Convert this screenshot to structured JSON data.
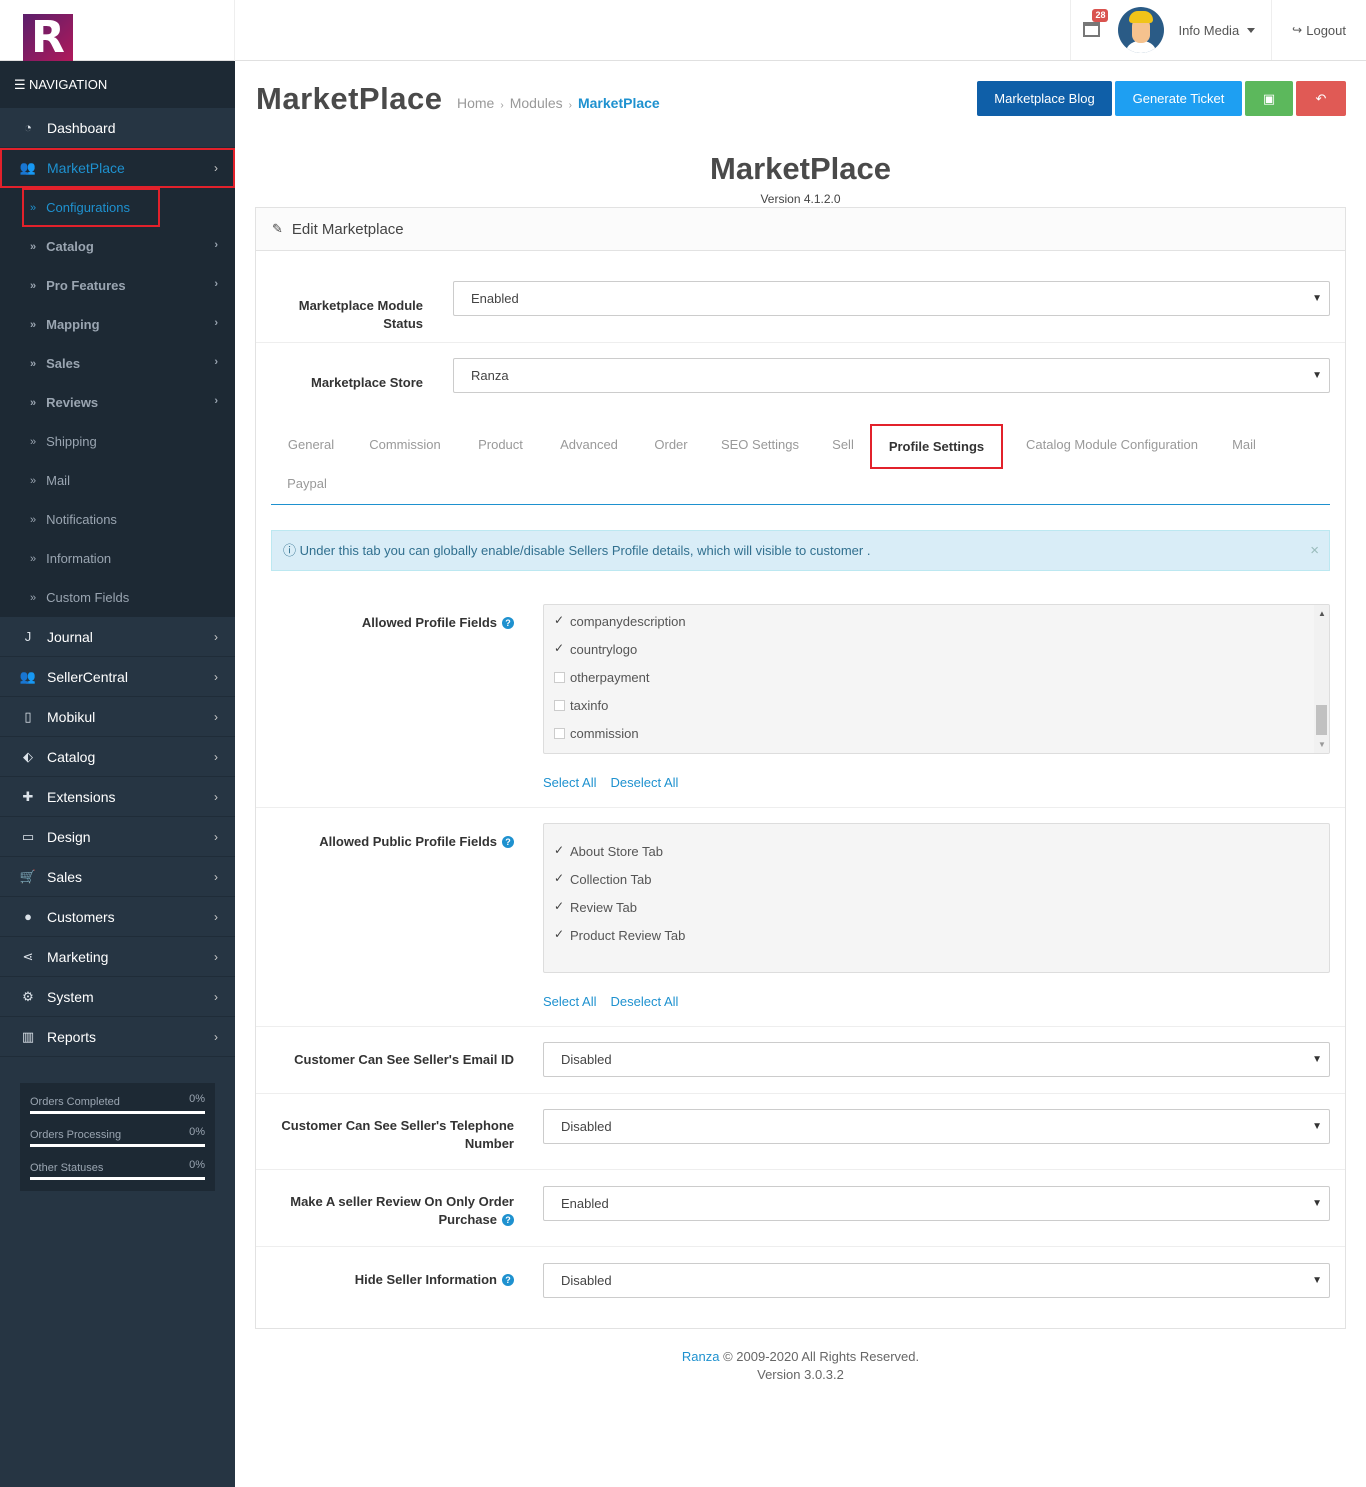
{
  "header": {
    "notification_count": "28",
    "user_name": "Info Media",
    "logout_label": "Logout"
  },
  "sidebar": {
    "nav_title": "NAVIGATION",
    "dashboard": "Dashboard",
    "marketplace": "MarketPlace",
    "sub_items": [
      {
        "label": "Configurations"
      },
      {
        "label": "Catalog"
      },
      {
        "label": "Pro Features"
      },
      {
        "label": "Mapping"
      },
      {
        "label": "Sales"
      },
      {
        "label": "Reviews"
      },
      {
        "label": "Shipping"
      },
      {
        "label": "Mail"
      },
      {
        "label": "Notifications"
      },
      {
        "label": "Information"
      },
      {
        "label": "Custom Fields"
      }
    ],
    "main_items": [
      {
        "label": "Journal",
        "icon": "journal-icon"
      },
      {
        "label": "SellerCentral",
        "icon": "users-icon"
      },
      {
        "label": "Mobikul",
        "icon": "mobile-icon"
      },
      {
        "label": "Catalog",
        "icon": "tags-icon"
      },
      {
        "label": "Extensions",
        "icon": "puzzle-icon"
      },
      {
        "label": "Design",
        "icon": "monitor-icon"
      },
      {
        "label": "Sales",
        "icon": "cart-icon"
      },
      {
        "label": "Customers",
        "icon": "user-icon"
      },
      {
        "label": "Marketing",
        "icon": "share-icon"
      },
      {
        "label": "System",
        "icon": "gear-icon"
      },
      {
        "label": "Reports",
        "icon": "bar-chart-icon"
      }
    ],
    "stats": [
      {
        "label": "Orders Completed",
        "value": "0%"
      },
      {
        "label": "Orders Processing",
        "value": "0%"
      },
      {
        "label": "Other Statuses",
        "value": "0%"
      }
    ]
  },
  "page": {
    "title": "MarketPlace",
    "breadcrumb": [
      "Home",
      "Modules",
      "MarketPlace"
    ],
    "buttons": {
      "blog": "Marketplace Blog",
      "ticket": "Generate Ticket"
    },
    "module_title": "MarketPlace",
    "module_version": "Version 4.1.2.0",
    "panel_title": "Edit Marketplace"
  },
  "form": {
    "module_status": {
      "label": "Marketplace Module Status",
      "value": "Enabled"
    },
    "store": {
      "label": "Marketplace Store",
      "value": "Ranza"
    },
    "tabs": [
      "General",
      "Commission",
      "Product",
      "Advanced",
      "Order",
      "SEO Settings",
      "Sell",
      "Profile Settings",
      "Catalog Module Configuration",
      "Mail",
      "Paypal"
    ],
    "active_tab": "Profile Settings",
    "info": "Under this tab you can globally enable/disable Sellers Profile details, which will visible to customer .",
    "profile_fields": {
      "label": "Allowed Profile Fields",
      "items": [
        {
          "name": "companydescription",
          "checked": true
        },
        {
          "name": "countrylogo",
          "checked": true
        },
        {
          "name": "otherpayment",
          "checked": false
        },
        {
          "name": "taxinfo",
          "checked": false
        },
        {
          "name": "commission",
          "checked": false
        }
      ]
    },
    "public_fields": {
      "label": "Allowed Public Profile Fields",
      "items": [
        {
          "name": "About Store Tab",
          "checked": true
        },
        {
          "name": "Collection Tab",
          "checked": true
        },
        {
          "name": "Review Tab",
          "checked": true
        },
        {
          "name": "Product Review Tab",
          "checked": true
        }
      ]
    },
    "select_all": "Select All",
    "deselect_all": "Deselect All",
    "email": {
      "label": "Customer Can See Seller's Email ID",
      "value": "Disabled"
    },
    "telephone": {
      "label": "Customer Can See Seller's Telephone Number",
      "value": "Disabled"
    },
    "review": {
      "label": "Make A seller Review On Only Order Purchase",
      "value": "Enabled"
    },
    "hide_info": {
      "label": "Hide Seller Information",
      "value": "Disabled"
    }
  },
  "footer": {
    "brand": "Ranza",
    "copyright": "© 2009-2020 All Rights Reserved.",
    "version": "Version 3.0.3.2"
  },
  "colors": {
    "accent": "#1e91cf",
    "sidebar": "#263543",
    "highlight": "#e2212b"
  }
}
